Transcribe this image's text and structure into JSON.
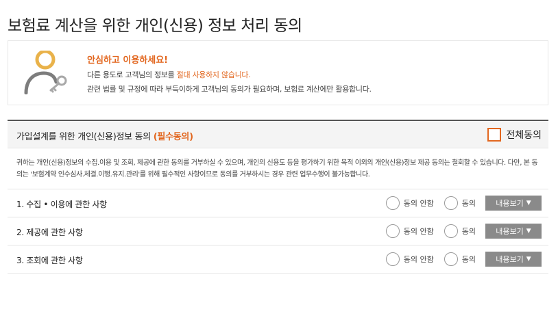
{
  "page": {
    "title": "보험료 계산을 위한 개인(신용) 정보 처리 동의"
  },
  "notice": {
    "headline": "안심하고 이용하세요!",
    "line1_before": "다른 용도로 고객님의 정보를 ",
    "line1_highlight": "절대 사용하지 않습니다.",
    "line2": "관련 법률 및 규정에 따라 부득이하게 고객님의 동의가 필요하며, 보험료 계산에만 활용합니다.",
    "icon": "person-key-icon",
    "colors": {
      "accent": "#e2661e",
      "gold": "#e9b24a",
      "gray": "#7d7d7d"
    }
  },
  "consent": {
    "title_main": "가입설계를 위한 개인(신용)정보 동의 ",
    "title_required": "(필수동의)",
    "agree_all_label": "전체동의",
    "description": "귀하는 개인(신용)정보의 수집.이용 및 조회, 제공에 관한 동의를 거부하실 수 있으며, 개인의 신용도 등을 평가하기 위한 목적 이외의 개인(신용)정보 제공 동의는 철회할 수 있습니다. 다만, 본 동의는 '보험계약 인수심사.체결.이행.유지.관리'를 위해 필수적인 사항이므로 동의를 거부하시는 경우 관련 업무수행이 불가능합니다.",
    "items": [
      {
        "title": "1. 수집 • 이용에 관한 사항",
        "disagree": "동의 안함",
        "agree": "동의",
        "view": "내용보기"
      },
      {
        "title": "2. 제공에 관한 사항",
        "disagree": "동의 안함",
        "agree": "동의",
        "view": "내용보기"
      },
      {
        "title": "3. 조회에 관한 사항",
        "disagree": "동의 안함",
        "agree": "동의",
        "view": "내용보기"
      }
    ]
  }
}
